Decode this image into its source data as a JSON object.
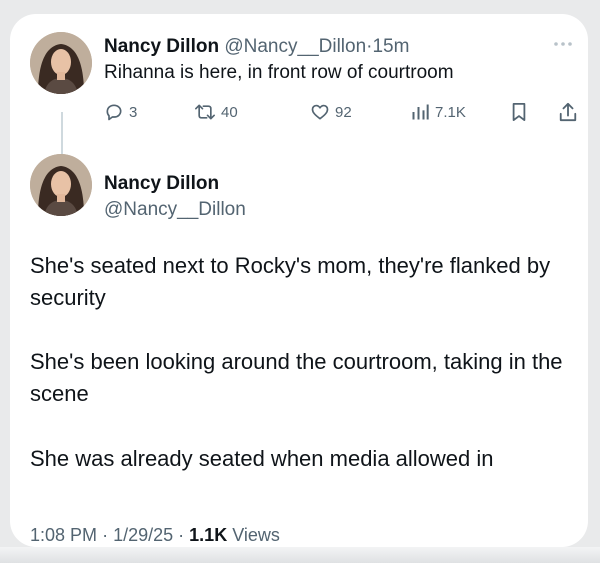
{
  "tweet_1": {
    "author_name": "Nancy Dillon",
    "author_handle": "@Nancy__Dillon",
    "separator": "·",
    "time_ago": "15m",
    "text": "Rihanna is here, in front row of courtroom",
    "actions": {
      "replies": "3",
      "reposts": "40",
      "likes": "92",
      "views": "7.1K"
    },
    "icons": {
      "more": "more-horizontal-icon",
      "reply": "reply-icon",
      "repost": "repost-icon",
      "like": "heart-icon",
      "views": "analytics-icon",
      "bookmark": "bookmark-icon",
      "share": "share-icon"
    }
  },
  "tweet_2": {
    "author_name": "Nancy Dillon",
    "author_handle": "@Nancy__Dillon",
    "paragraphs": [
      "She's seated next to Rocky's mom, they're flanked by security",
      "She's been looking around the courtroom, taking in the scene",
      "She was already seated when media allowed in"
    ],
    "time": "1:08 PM",
    "date": "1/29/25",
    "separator": "·",
    "views_count": "1.1K",
    "views_label": "Views"
  },
  "colors": {
    "text_primary": "#0f1419",
    "text_secondary": "#536471",
    "thread_line": "#cfd9de",
    "card_background": "#ffffff"
  }
}
